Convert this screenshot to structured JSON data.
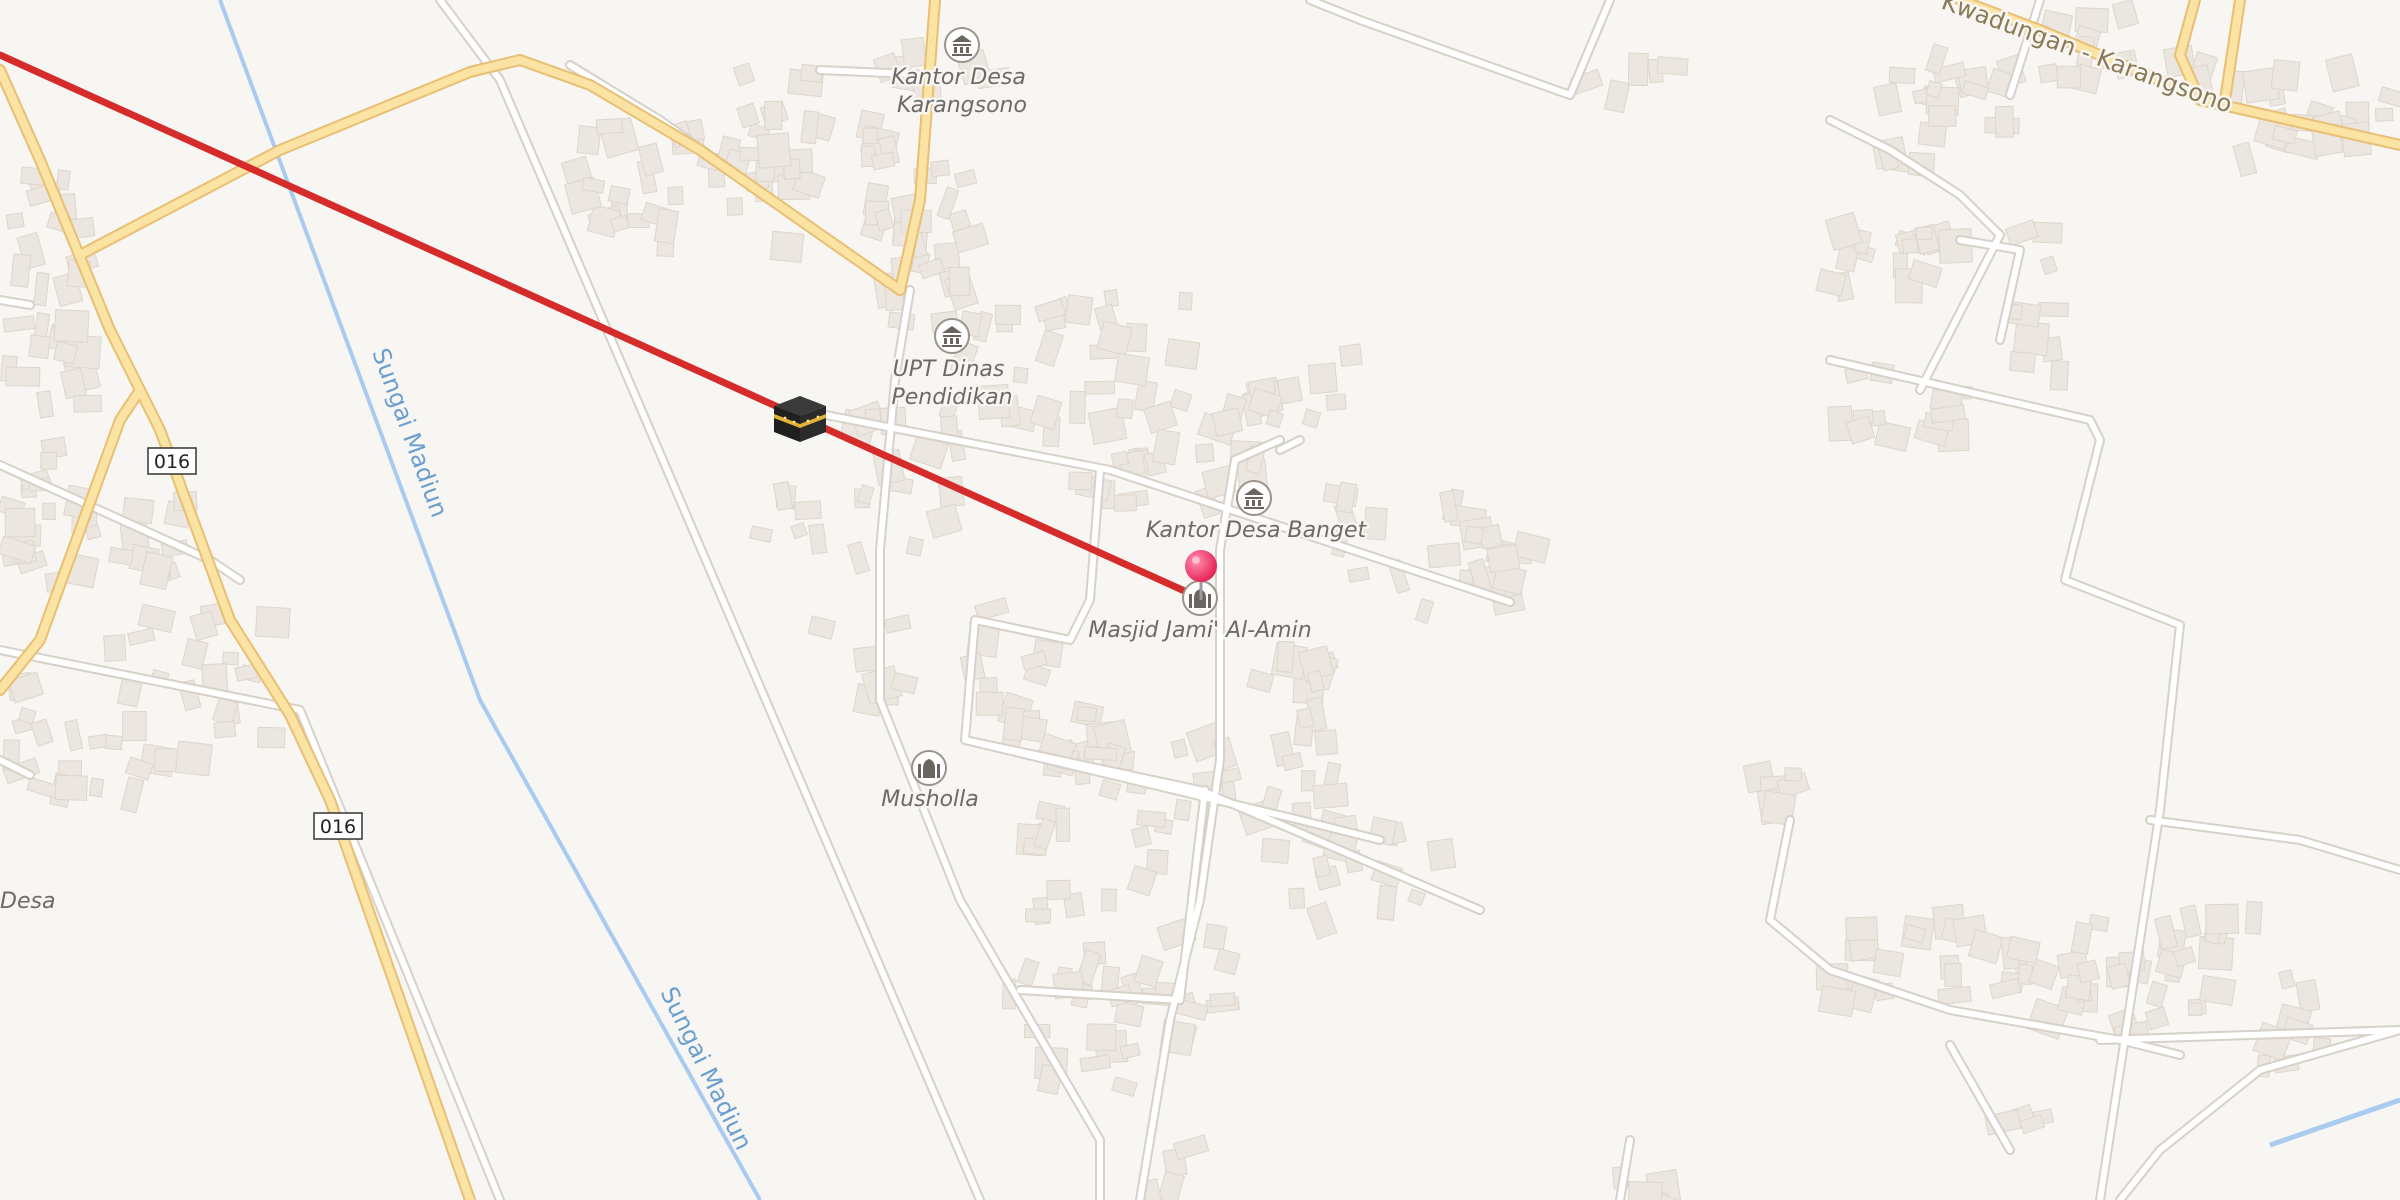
{
  "map": {
    "place_labels": [
      {
        "id": "kantor-desa-karangsono",
        "lines": [
          "Kantor Desa",
          "Karangsono"
        ],
        "icon": "government-building-icon"
      },
      {
        "id": "upt-dinas-pendidikan",
        "lines": [
          "UPT Dinas",
          "Pendidikan"
        ],
        "icon": "government-building-icon"
      },
      {
        "id": "kantor-desa-banget",
        "lines": [
          "Kantor Desa Banget"
        ],
        "icon": "government-building-icon"
      },
      {
        "id": "masjid-jami-al-amin",
        "lines": [
          "Masjid Jami' Al-Amin"
        ],
        "icon": "mosque-icon"
      },
      {
        "id": "musholla",
        "lines": [
          "Musholla"
        ],
        "icon": "mosque-icon"
      },
      {
        "id": "desa-partial",
        "lines": [
          "Desa"
        ],
        "icon": null
      }
    ],
    "road_shields": [
      "016",
      "016"
    ],
    "road_name": "Kwadungan - Karangsono",
    "river_name": "Sungai Madiun",
    "markers": {
      "pin": {
        "name": "location-pin",
        "color": "#e8265a"
      },
      "kaaba": {
        "name": "kaaba-icon"
      },
      "qibla_line": {
        "color": "#d52b2b"
      }
    },
    "colors": {
      "background": "#f8f6f2",
      "building": "#ebe6df",
      "minor_road": "#ffffff",
      "minor_road_casing": "#dcd7d0",
      "major_road": "#fbe3a3",
      "major_road_casing": "#e8bf74",
      "river": "#a8cbef"
    }
  }
}
